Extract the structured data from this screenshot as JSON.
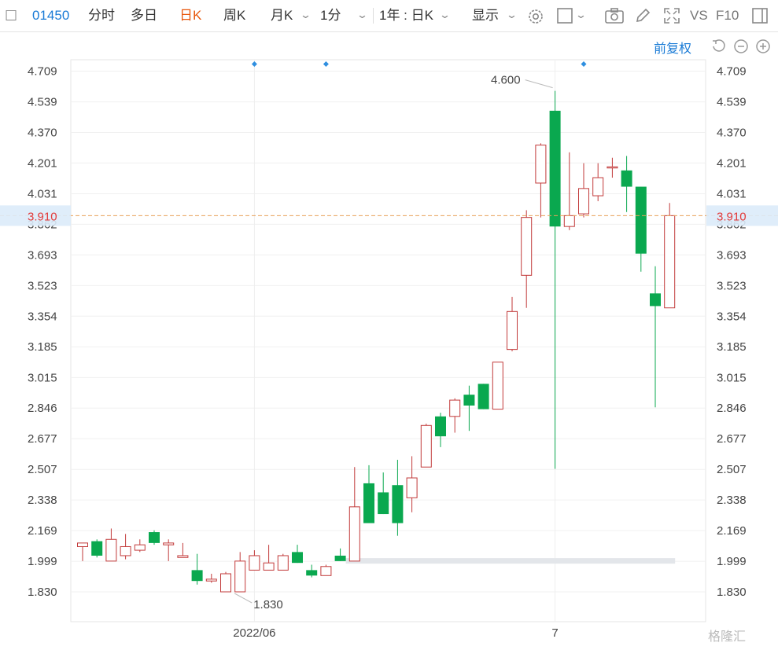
{
  "toolbar": {
    "code": "01450",
    "tabs": [
      "分时",
      "多日",
      "日K",
      "周K",
      "月K",
      "1分"
    ],
    "active_tab": "日K",
    "range_select": "1年 : 日K",
    "display_label": "显示",
    "vs_label": "VS",
    "f10_label": "F10"
  },
  "chart_controls": {
    "adjust_label": "前复权"
  },
  "watermark": "格隆汇",
  "colors": {
    "up": "#c23a3a",
    "down": "#0aa84f",
    "accent": "#1a7bd6",
    "price_line": "#e8a15a",
    "price_label": "#e23b3b"
  },
  "chart_data": {
    "type": "candlestick",
    "y_ticks": [
      "4.709",
      "4.539",
      "4.370",
      "4.201",
      "4.031",
      "3.862",
      "3.693",
      "3.523",
      "3.354",
      "3.185",
      "3.015",
      "2.846",
      "2.677",
      "2.507",
      "2.338",
      "2.169",
      "1.999",
      "1.830"
    ],
    "ylim": [
      1.83,
      4.709
    ],
    "x_labels": [
      {
        "label": "2022/06",
        "index": 12
      },
      {
        "label": "7",
        "index": 33
      }
    ],
    "current_price": 3.91,
    "current_price_label": "3.910",
    "high_annotation": {
      "label": "4.600",
      "index": 33,
      "value": 4.6
    },
    "low_annotation": {
      "label": "1.830",
      "index": 11,
      "value": 1.83
    },
    "event_markers": [
      12,
      17,
      35
    ],
    "candles": [
      {
        "o": 2.08,
        "h": 2.1,
        "l": 2.0,
        "c": 2.1
      },
      {
        "o": 2.11,
        "h": 2.12,
        "l": 2.02,
        "c": 2.03
      },
      {
        "o": 2.0,
        "h": 2.18,
        "l": 2.0,
        "c": 2.12
      },
      {
        "o": 2.03,
        "h": 2.15,
        "l": 2.01,
        "c": 2.08
      },
      {
        "o": 2.06,
        "h": 2.12,
        "l": 2.05,
        "c": 2.09
      },
      {
        "o": 2.16,
        "h": 2.17,
        "l": 2.09,
        "c": 2.1
      },
      {
        "o": 2.09,
        "h": 2.12,
        "l": 2.0,
        "c": 2.1
      },
      {
        "o": 2.02,
        "h": 2.1,
        "l": 2.02,
        "c": 2.03
      },
      {
        "o": 1.95,
        "h": 2.04,
        "l": 1.87,
        "c": 1.89
      },
      {
        "o": 1.89,
        "h": 1.93,
        "l": 1.88,
        "c": 1.9
      },
      {
        "o": 1.83,
        "h": 1.94,
        "l": 1.83,
        "c": 1.93
      },
      {
        "o": 1.83,
        "h": 2.05,
        "l": 1.83,
        "c": 2.0
      },
      {
        "o": 1.95,
        "h": 2.06,
        "l": 1.95,
        "c": 2.03
      },
      {
        "o": 1.95,
        "h": 2.09,
        "l": 1.95,
        "c": 1.99
      },
      {
        "o": 1.95,
        "h": 2.04,
        "l": 1.95,
        "c": 2.03
      },
      {
        "o": 2.05,
        "h": 2.09,
        "l": 1.99,
        "c": 1.99
      },
      {
        "o": 1.95,
        "h": 1.98,
        "l": 1.91,
        "c": 1.92
      },
      {
        "o": 1.92,
        "h": 1.98,
        "l": 1.92,
        "c": 1.97
      },
      {
        "o": 2.03,
        "h": 2.07,
        "l": 2.0,
        "c": 2.0
      },
      {
        "o": 2.0,
        "h": 2.52,
        "l": 2.0,
        "c": 2.3
      },
      {
        "o": 2.43,
        "h": 2.53,
        "l": 2.21,
        "c": 2.21
      },
      {
        "o": 2.38,
        "h": 2.49,
        "l": 2.26,
        "c": 2.26
      },
      {
        "o": 2.42,
        "h": 2.56,
        "l": 2.14,
        "c": 2.21
      },
      {
        "o": 2.35,
        "h": 2.58,
        "l": 2.27,
        "c": 2.46
      },
      {
        "o": 2.52,
        "h": 2.76,
        "l": 2.52,
        "c": 2.75
      },
      {
        "o": 2.8,
        "h": 2.82,
        "l": 2.63,
        "c": 2.69
      },
      {
        "o": 2.8,
        "h": 2.9,
        "l": 2.71,
        "c": 2.89
      },
      {
        "o": 2.92,
        "h": 2.97,
        "l": 2.72,
        "c": 2.86
      },
      {
        "o": 2.98,
        "h": 2.98,
        "l": 2.84,
        "c": 2.84
      },
      {
        "o": 2.84,
        "h": 3.1,
        "l": 2.84,
        "c": 3.1
      },
      {
        "o": 3.17,
        "h": 3.46,
        "l": 3.16,
        "c": 3.38
      },
      {
        "o": 3.58,
        "h": 3.94,
        "l": 3.4,
        "c": 3.9
      },
      {
        "o": 4.09,
        "h": 4.31,
        "l": 3.9,
        "c": 4.3
      },
      {
        "o": 4.49,
        "h": 4.6,
        "l": 2.51,
        "c": 3.85
      },
      {
        "o": 3.85,
        "h": 4.26,
        "l": 3.83,
        "c": 3.91
      },
      {
        "o": 3.92,
        "h": 4.2,
        "l": 3.9,
        "c": 4.06
      },
      {
        "o": 4.02,
        "h": 4.2,
        "l": 3.99,
        "c": 4.12
      },
      {
        "o": 4.18,
        "h": 4.23,
        "l": 4.12,
        "c": 4.18
      },
      {
        "o": 4.16,
        "h": 4.24,
        "l": 3.93,
        "c": 4.07
      },
      {
        "o": 4.07,
        "h": 4.07,
        "l": 3.6,
        "c": 3.7
      },
      {
        "o": 3.48,
        "h": 3.63,
        "l": 2.85,
        "c": 3.41
      },
      {
        "o": 3.4,
        "h": 3.98,
        "l": 3.4,
        "c": 3.91
      }
    ]
  }
}
